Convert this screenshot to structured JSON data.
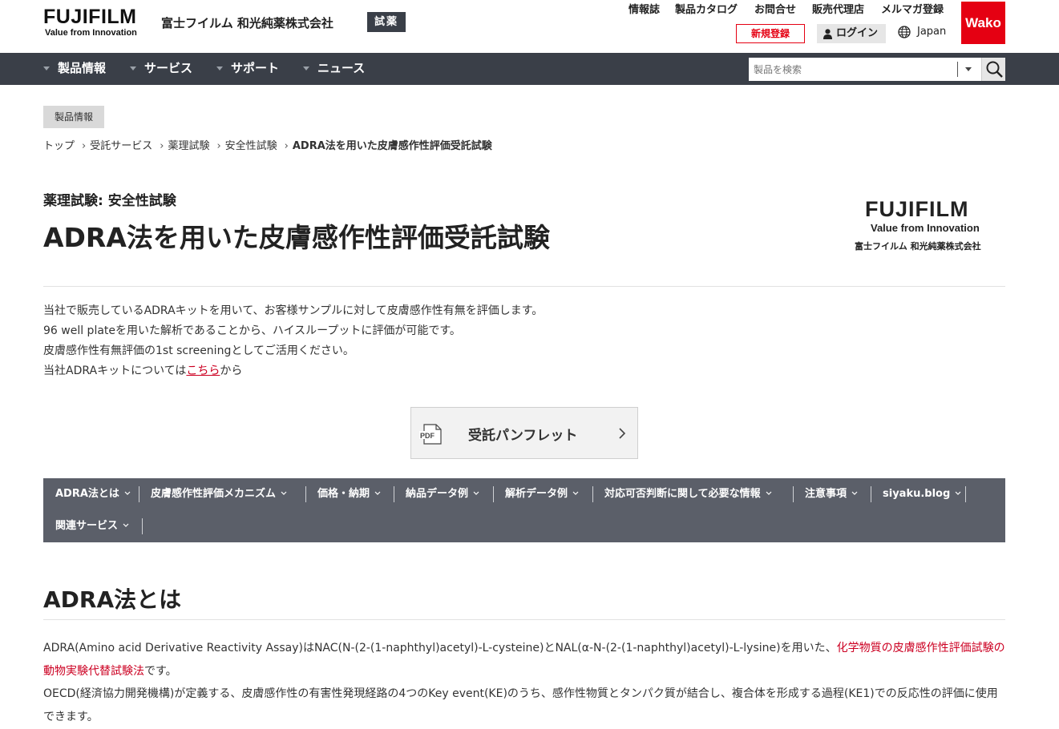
{
  "header": {
    "logo_text": "FUJIFILM",
    "logo_tagline": "Value from Innovation",
    "company_name": "富士フイルム 和光純薬株式会社",
    "site_badge": "試薬",
    "utility_links": [
      "情報誌",
      "製品カタログ",
      "お問合せ",
      "販売代理店",
      "メルマガ登録"
    ],
    "brand_badge": "Wako",
    "register_label": "新規登録",
    "login_label": "ログイン",
    "language": "Japan"
  },
  "nav": {
    "items": [
      "製品情報",
      "サービス",
      "サポート",
      "ニュース"
    ],
    "search_placeholder": "製品を検索"
  },
  "page": {
    "category_tag": "製品情報",
    "breadcrumb": [
      "トップ",
      "受託サービス",
      "薬理試験",
      "安全性試験",
      "ADRA法を用いた皮膚感作性評価受託試験"
    ],
    "subcategory": "薬理試験: 安全性試験",
    "title": "ADRA法を用いた皮膚感作性評価受託試験",
    "side_logo": {
      "word": "FUJIFILM",
      "tagline": "Value from Innovation",
      "company": "富士フイルム 和光純薬株式会社"
    },
    "intro": {
      "line1": "当社で販売しているADRAキットを用いて、お客様サンプルに対して皮膚感作性有無を評価します。",
      "line2": "96 well plateを用いた解析であることから、ハイスループットに評価が可能です。",
      "line3": "皮膚感作性有無評価の1st screeningとしてご活用ください。",
      "line4_before": "当社ADRAキットについては",
      "line4_link": "こちら",
      "line4_after": "から"
    },
    "pamphlet": {
      "icon_text": "PDF",
      "label": "受託パンフレット"
    },
    "anchor_nav": [
      "ADRA法とは",
      "皮膚感作性評価メカニズム",
      "価格・納期",
      "納品データ例",
      "解析データ例",
      "対応可否判断に関して必要な情報",
      "注意事項",
      "siyaku.blog",
      "関連サービス"
    ],
    "section": {
      "title": "ADRA法とは",
      "p1_before": "ADRA(Amino acid Derivative Reactivity Assay)はNAC(N-(2-(1-naphthyl)acetyl)-L-cysteine)とNAL(α-N-(2-(1-naphthyl)acetyl)-L-lysine)を用いた、",
      "p1_link": "化学物質の皮膚感作性評価試験の動物実験代替試験法",
      "p1_after": "です。",
      "p2": "OECD(経済協力開発機構)が定義する、皮膚感作性の有害性発現経路の4つのKey event(KE)のうち、感作性物質とタンパク質が結合し、複合体を形成する過程(KE1)での反応性の評価に使用できます。"
    }
  },
  "colors": {
    "accent_red": "#e50012",
    "nav_bg": "#3a3f48",
    "anchor_bg": "#5b5f69",
    "link_red": "#cc0022"
  }
}
